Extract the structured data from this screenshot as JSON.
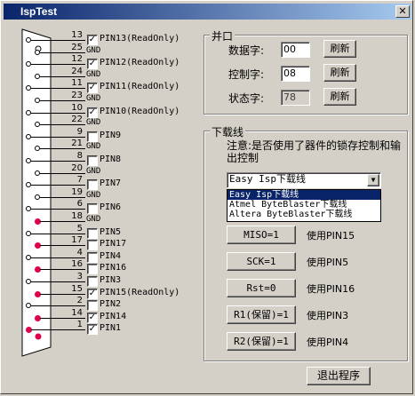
{
  "window": {
    "title": "IspTest",
    "close_glyph": "✕"
  },
  "pins": [
    {
      "num": "13",
      "label": "PIN13(ReadOnly)",
      "checked": true,
      "red": false
    },
    {
      "num": "25",
      "label": "GND",
      "checked": false,
      "red": false,
      "gnd": true
    },
    {
      "num": "12",
      "label": "PIN12(ReadOnly)",
      "checked": true,
      "red": false
    },
    {
      "num": "24",
      "label": "GND",
      "gnd": true,
      "red": false
    },
    {
      "num": "11",
      "label": "PIN11(ReadOnly)",
      "checked": true,
      "red": false
    },
    {
      "num": "23",
      "label": "GND",
      "gnd": true,
      "red": false
    },
    {
      "num": "10",
      "label": "PIN10(ReadOnly)",
      "checked": true,
      "red": false
    },
    {
      "num": "22",
      "label": "GND",
      "gnd": true,
      "red": false
    },
    {
      "num": "9",
      "label": "PIN9",
      "checked": false,
      "red": false
    },
    {
      "num": "21",
      "label": "GND",
      "gnd": true,
      "red": false
    },
    {
      "num": "8",
      "label": "PIN8",
      "checked": false,
      "red": false
    },
    {
      "num": "20",
      "label": "GND",
      "gnd": true,
      "red": false
    },
    {
      "num": "7",
      "label": "PIN7",
      "checked": false,
      "red": false
    },
    {
      "num": "19",
      "label": "GND",
      "gnd": true,
      "red": false
    },
    {
      "num": "6",
      "label": "PIN6",
      "checked": false,
      "red": false
    },
    {
      "num": "18",
      "label": "GND",
      "gnd": true,
      "red": true
    },
    {
      "num": "5",
      "label": "PIN5",
      "checked": false,
      "red": false
    },
    {
      "num": "17",
      "label": "PIN17",
      "checked": false,
      "red": true
    },
    {
      "num": "4",
      "label": "PIN4",
      "checked": false,
      "red": false
    },
    {
      "num": "16",
      "label": "PIN16",
      "checked": false,
      "red": true
    },
    {
      "num": "3",
      "label": "PIN3",
      "checked": false,
      "red": false
    },
    {
      "num": "15",
      "label": "PIN15(ReadOnly)",
      "checked": true,
      "red": true
    },
    {
      "num": "2",
      "label": "PIN2",
      "checked": false,
      "red": false
    },
    {
      "num": "14",
      "label": "PIN14",
      "checked": true,
      "red": true
    },
    {
      "num": "1",
      "label": "PIN1",
      "checked": true,
      "red": true
    }
  ],
  "port_group": {
    "title": "并口",
    "data_label": "数据字:",
    "data_value": "00",
    "control_label": "控制字:",
    "control_value": "08",
    "status_label": "状态字:",
    "status_value": "78",
    "refresh_label": "刷新"
  },
  "download_group": {
    "title": "下载线",
    "notice": "注意:是否使用了器件的锁存控制和输出控制",
    "selected": "Easy Isp下载线",
    "options": [
      "Easy Isp下载线",
      "Atmel ByteBlaster下载线",
      "Altera ByteBlaster下载线"
    ],
    "signals": [
      {
        "button": "MISO=1",
        "pin": "使用PIN15"
      },
      {
        "button": "SCK=1",
        "pin": "使用PIN5"
      },
      {
        "button": "Rst=0",
        "pin": "使用PIN16"
      },
      {
        "button": "R1(保留)=1",
        "pin": "使用PIN3"
      },
      {
        "button": "R2(保留)=1",
        "pin": "使用PIN4"
      }
    ]
  },
  "exit_label": "退出程序"
}
